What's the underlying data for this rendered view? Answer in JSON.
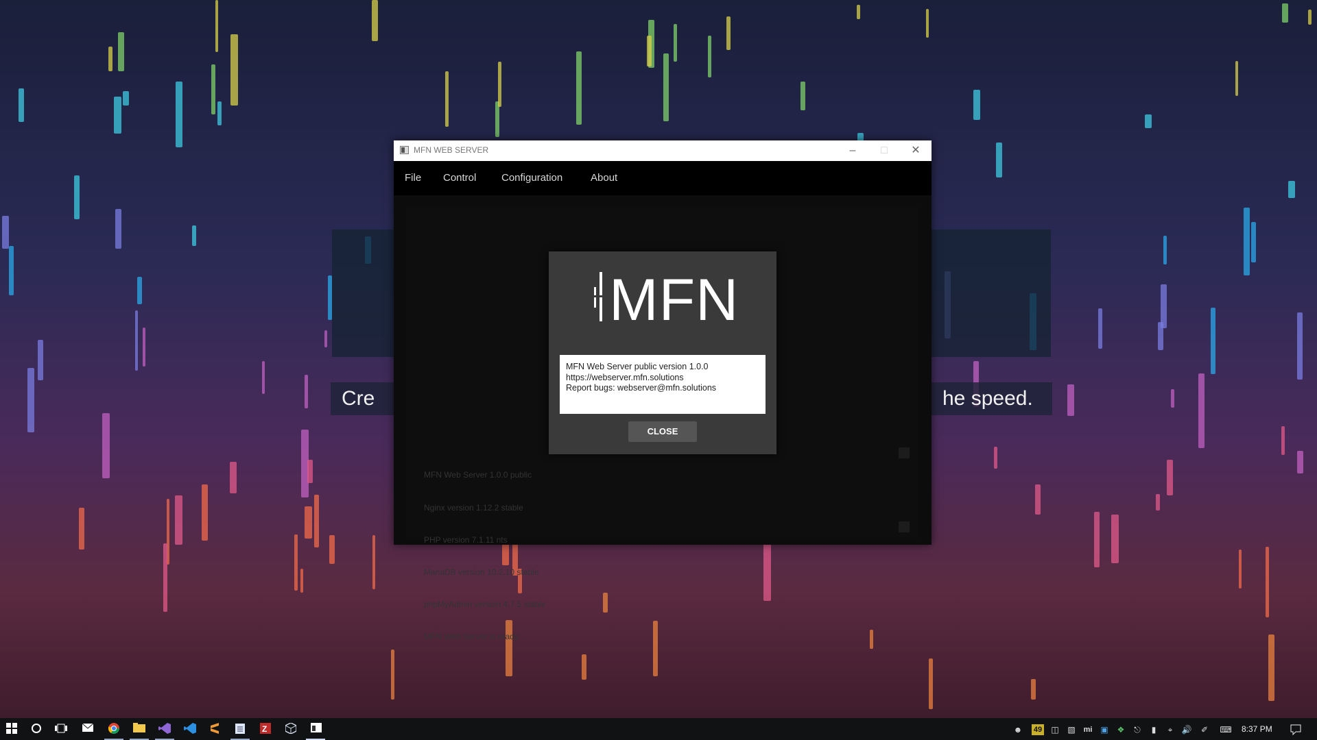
{
  "desktop": {
    "banner_left_text": "Cre",
    "banner_right_text": "he speed."
  },
  "window": {
    "title": "MFN WEB SERVER",
    "controls": {
      "minimize": "–",
      "maximize": "□",
      "close": "✕"
    },
    "menu": [
      "File",
      "Control",
      "Configuration",
      "About"
    ],
    "log_lines": [
      "MFN Web Server 1.0.0 public",
      "Nginx version 1.12.2 stable",
      "PHP version 7.1.11 nts",
      "MariaDB version 10.2.10 stable",
      "phpMyAdmin version 4.7.5 stable",
      "MFN Web Server is ready..."
    ]
  },
  "about_dialog": {
    "logo_text": "MFN",
    "info_lines": [
      "MFN Web Server public version 1.0.0",
      "https://webserver.mfn.solutions",
      "Report bugs: webserver@mfn.solutions"
    ],
    "close_label": "CLOSE"
  },
  "taskbar": {
    "pinned_icons": [
      "windows-start-icon",
      "cortana-search-icon",
      "task-view-icon",
      "mail-icon",
      "chrome-icon",
      "file-explorer-icon",
      "visual-studio-icon",
      "vscode-icon",
      "sublime-text-icon",
      "notepad-icon",
      "filezilla-icon",
      "box-app-icon",
      "mfn-web-server-icon"
    ],
    "tray_badge": "49",
    "clock": "8:37 PM"
  },
  "colors": {
    "window_bg": "#0c0c0c",
    "dialog_bg": "#3a3a3a",
    "button_bg": "#555555"
  }
}
